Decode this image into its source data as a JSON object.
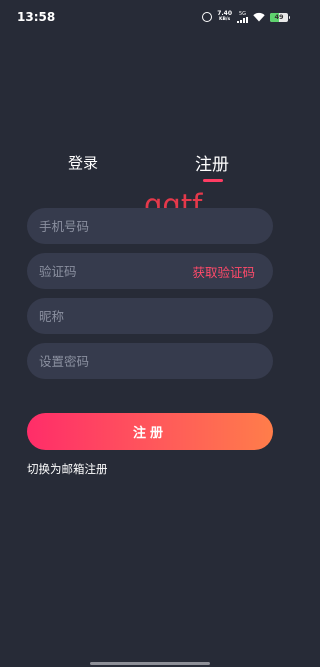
{
  "status_bar": {
    "time": "13:58",
    "net_speed_value": "7.40",
    "net_speed_unit": "KB/s",
    "signal_label": "5G",
    "battery_level": "49"
  },
  "tabs": {
    "login_label": "登录",
    "register_label": "注册",
    "active": "register"
  },
  "watermark": "qqtf",
  "form": {
    "phone_placeholder": "手机号码",
    "code_placeholder": "验证码",
    "get_code_label": "获取验证码",
    "nickname_placeholder": "昵称",
    "password_placeholder": "设置密码",
    "submit_label": "注册",
    "switch_label": "切换为邮箱注册"
  },
  "colors": {
    "background": "#272b37",
    "field_bg": "#363b4d",
    "accent": "#ff3d63",
    "button_gradient_start": "#ff2d69",
    "button_gradient_end": "#ff7d4a"
  }
}
